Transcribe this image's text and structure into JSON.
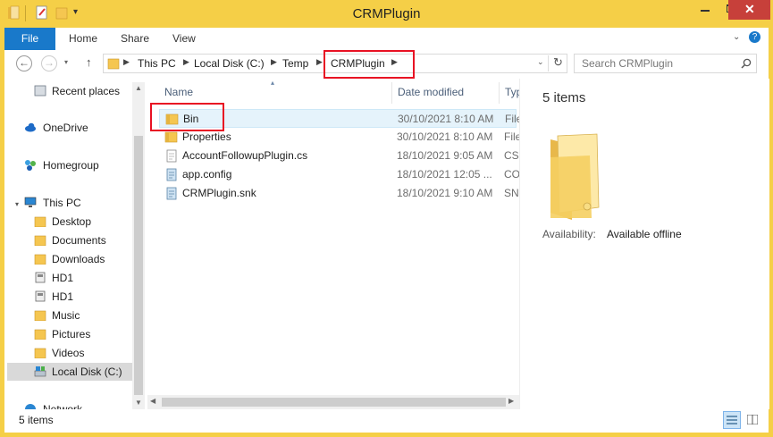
{
  "window": {
    "title": "CRMPlugin"
  },
  "ribbon": {
    "tabs": [
      "File",
      "Home",
      "Share",
      "View"
    ]
  },
  "address": {
    "crumbs": [
      "This PC",
      "Local Disk (C:)",
      "Temp",
      "CRMPlugin"
    ],
    "search_placeholder": "Search CRMPlugin"
  },
  "nav": {
    "items": [
      {
        "label": "Recent places",
        "icon": "recent-places-icon"
      },
      {
        "label": "OneDrive",
        "icon": "onedrive-icon"
      },
      {
        "label": "Homegroup",
        "icon": "homegroup-icon"
      },
      {
        "label": "This PC",
        "icon": "computer-icon"
      },
      {
        "label": "Desktop",
        "icon": "folder-icon"
      },
      {
        "label": "Documents",
        "icon": "folder-icon"
      },
      {
        "label": "Downloads",
        "icon": "folder-icon"
      },
      {
        "label": "HD1",
        "icon": "drive-icon"
      },
      {
        "label": "HD1",
        "icon": "drive-icon"
      },
      {
        "label": "Music",
        "icon": "folder-icon"
      },
      {
        "label": "Pictures",
        "icon": "folder-icon"
      },
      {
        "label": "Videos",
        "icon": "folder-icon"
      },
      {
        "label": "Local Disk (C:)",
        "icon": "disk-icon"
      },
      {
        "label": "Network",
        "icon": "network-icon"
      }
    ]
  },
  "files": {
    "columns": [
      "Name",
      "Date modified",
      "Typ"
    ],
    "rows": [
      {
        "name": "Bin",
        "date": "30/10/2021 8:10 AM",
        "type": "File",
        "icon": "folder-icon"
      },
      {
        "name": "Properties",
        "date": "30/10/2021 8:10 AM",
        "type": "File",
        "icon": "folder-icon"
      },
      {
        "name": "AccountFollowupPlugin.cs",
        "date": "18/10/2021 9:05 AM",
        "type": "CS",
        "icon": "cs-file-icon"
      },
      {
        "name": "app.config",
        "date": "18/10/2021 12:05 ...",
        "type": "CO",
        "icon": "config-file-icon"
      },
      {
        "name": "CRMPlugin.snk",
        "date": "18/10/2021 9:10 AM",
        "type": "SN",
        "icon": "snk-file-icon"
      }
    ]
  },
  "details": {
    "count": "5 items",
    "availability_label": "Availability:",
    "availability_value": "Available offline"
  },
  "status": {
    "text": "5 items"
  },
  "colors": {
    "title_bar": "#f5cf47",
    "file_tab": "#1979ca",
    "highlight_box": "#e81123",
    "selected_row": "#e5f3fb"
  }
}
